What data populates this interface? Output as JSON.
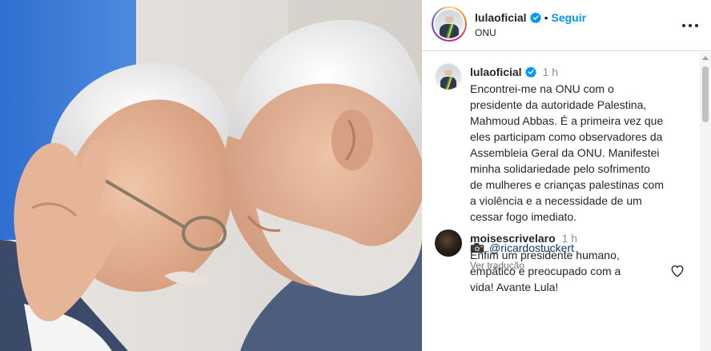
{
  "header": {
    "username": "lulaoficial",
    "separator": "•",
    "follow_label": "Seguir",
    "location": "ONU",
    "menu_icon": "more-horizontal-icon"
  },
  "caption": {
    "username": "lulaoficial",
    "time": "1 h",
    "text": "Encontrei-me na ONU com o\npresidente da autoridade Palestina,\nMahmoud Abbas. É a primeira vez que\neles participam como observadores da\nAssembleia Geral da ONU. Manifestei\nminha solidariedade pelo sofrimento\nde mulheres e crianças palestinas com\na violência e a necessidade de um\ncessar fogo imediato.",
    "credit_emoji": "camera-icon",
    "credit": "@ricardostuckert",
    "translate_label": "Ver tradução"
  },
  "comment": {
    "username": "moisescrivelaro",
    "time": "1 h",
    "text": "Enfim um presidente humano,\nempático e preocupado com a\nvida! Avante Lula!",
    "like_icon": "heart-outline-icon"
  },
  "colors": {
    "link_blue": "#0095f6",
    "verified_blue": "#0095f6",
    "secondary_text": "#8e8e8e",
    "divider": "#dbdbdb"
  }
}
